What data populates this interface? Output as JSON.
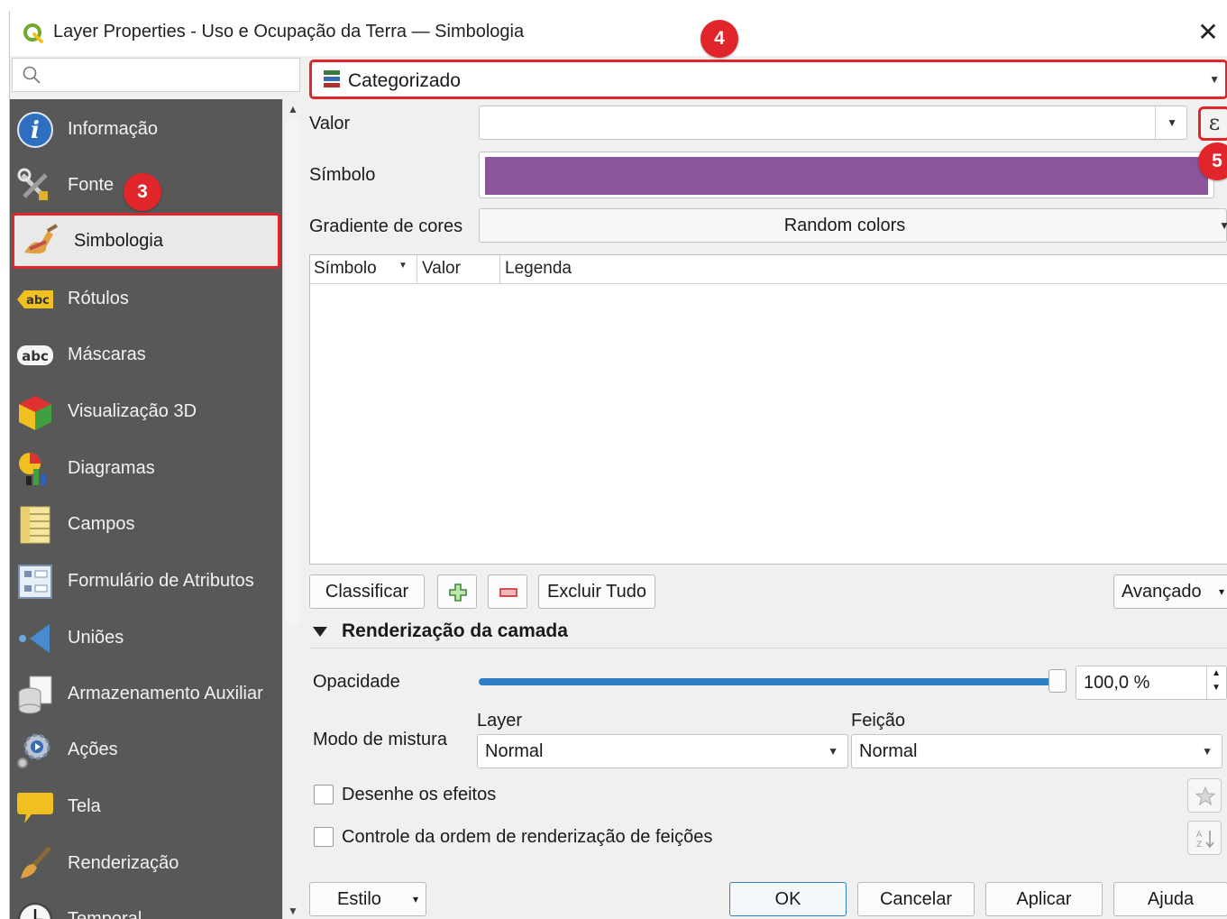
{
  "window": {
    "title": "Layer Properties - Uso e Ocupação da Terra — Simbologia",
    "close_glyph": "✕"
  },
  "sidebar": {
    "search_placeholder": "",
    "items": [
      {
        "label": "Informação",
        "icon": "info-icon"
      },
      {
        "label": "Fonte",
        "icon": "source-tools-icon"
      },
      {
        "label": "Simbologia",
        "icon": "paintbrush-icon",
        "active": true
      },
      {
        "label": "Rótulos",
        "icon": "labels-abc-icon"
      },
      {
        "label": "Máscaras",
        "icon": "masks-abc-icon"
      },
      {
        "label": "Visualização 3D",
        "icon": "cube-3d-icon"
      },
      {
        "label": "Diagramas",
        "icon": "diagrams-icon"
      },
      {
        "label": "Campos",
        "icon": "fields-icon"
      },
      {
        "label": "Formulário de Atributos",
        "icon": "attributes-form-icon"
      },
      {
        "label": "Uniões",
        "icon": "joins-icon"
      },
      {
        "label": "Armazenamento Auxiliar",
        "icon": "auxiliary-storage-icon"
      },
      {
        "label": "Ações",
        "icon": "actions-gear-icon"
      },
      {
        "label": "Tela",
        "icon": "display-bubble-icon"
      },
      {
        "label": "Renderização",
        "icon": "rendering-brush-icon"
      },
      {
        "label": "Temporal",
        "icon": "temporal-clock-icon"
      }
    ]
  },
  "renderer": {
    "selected": "Categorizado"
  },
  "form": {
    "valor_label": "Valor",
    "valor_value": "",
    "expression_glyph": "ε",
    "simbolo_label": "Símbolo",
    "symbol_color": "#8a559a",
    "gradiente_label": "Gradiente de cores",
    "gradiente_value": "Random colors"
  },
  "table": {
    "headers": [
      "Símbolo",
      "Valor",
      "Legenda"
    ],
    "rows": []
  },
  "buttons": {
    "classificar": "Classificar",
    "excluir_tudo": "Excluir Tudo",
    "avancado": "Avançado"
  },
  "layer_rendering": {
    "title": "Renderização da camada",
    "opacidade_label": "Opacidade",
    "opacidade_percent": 100,
    "opacidade_value": "100,0 %",
    "modo_mistura_label": "Modo de mistura",
    "layer_label": "Layer",
    "layer_value": "Normal",
    "feicao_label": "Feição",
    "feicao_value": "Normal",
    "desenhe_efeitos": "Desenhe os efeitos",
    "controle_ordem": "Controle da ordem de renderização de feições"
  },
  "footer": {
    "estilo": "Estilo",
    "ok": "OK",
    "cancelar": "Cancelar",
    "aplicar": "Aplicar",
    "ajuda": "Ajuda"
  },
  "annotations": {
    "badge_3": "3",
    "badge_4": "4",
    "badge_5": "5",
    "color": "#e0252b"
  }
}
